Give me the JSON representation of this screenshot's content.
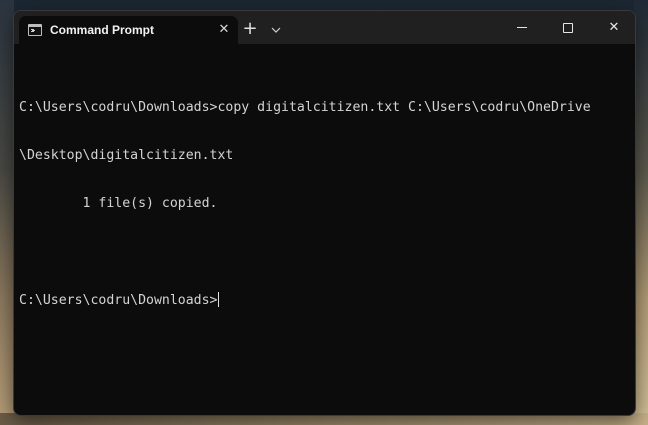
{
  "window": {
    "tab_title": "Command Prompt",
    "tab_icon": "cmd-icon",
    "tab_close_glyph": "✕",
    "new_tab_glyph": "+",
    "dropdown_glyph": "⌄",
    "close_glyph": "✕"
  },
  "terminal": {
    "lines": [
      "C:\\Users\\codru\\Downloads>copy digitalcitizen.txt C:\\Users\\codru\\OneDrive",
      "\\Desktop\\digitalcitizen.txt",
      "        1 file(s) copied.",
      "",
      "C:\\Users\\codru\\Downloads>"
    ]
  },
  "colors": {
    "terminal_bg": "#0c0c0c",
    "titlebar_bg": "#202020",
    "text": "#d4d4d4"
  }
}
